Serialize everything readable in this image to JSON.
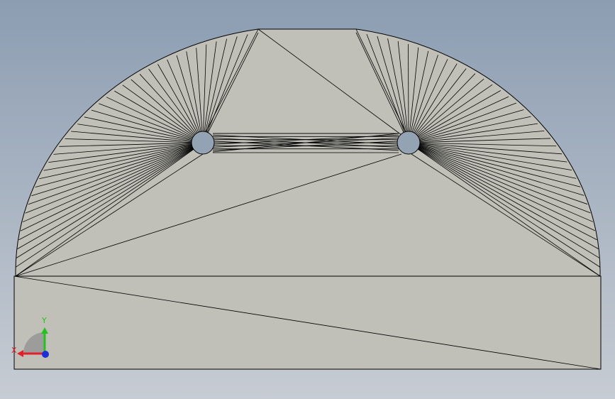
{
  "viewport": {
    "background_top": "#8c9db2",
    "background_bottom": "#c7ccd3"
  },
  "part": {
    "fill": "#c0c0b8",
    "edge_color": "#000000",
    "hole_fill": "#94a3b3"
  },
  "triad": {
    "x_label": "X",
    "y_label": "Y",
    "x_color": "#e0202a",
    "y_color": "#23c21e",
    "z_color": "#1e2fd6"
  }
}
